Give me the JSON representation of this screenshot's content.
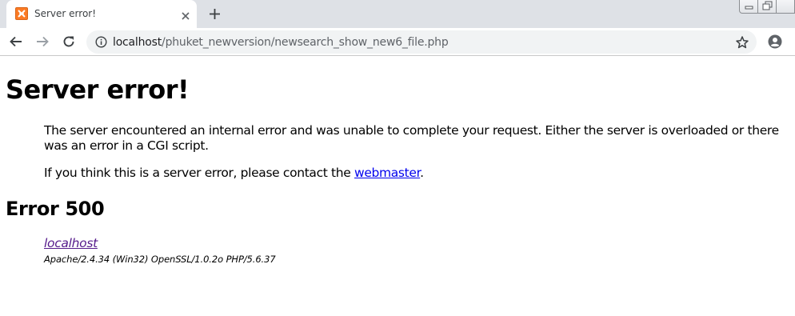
{
  "browser": {
    "tab": {
      "title": "Server error!",
      "favicon": "xampp-favicon"
    },
    "address_bar": {
      "host": "localhost",
      "path": "/phuket_newversion/newsearch_show_new6_file.php"
    },
    "icons": {
      "back": "back-arrow-icon",
      "forward": "forward-arrow-icon",
      "reload": "reload-icon",
      "info": "info-icon",
      "bookmark": "star-icon",
      "account": "account-icon",
      "close_tab": "close-icon",
      "new_tab": "plus-icon"
    },
    "colors": {
      "tabstrip_bg": "#dee1e6",
      "omnibox_bg": "#f1f3f4",
      "favicon": "#fb7a24"
    }
  },
  "page": {
    "heading": "Server error!",
    "message": "The server encountered an internal error and was unable to complete your request. Either the server is overloaded or there was an error in a CGI script.",
    "contact_prefix": "If you think this is a server error, please contact the ",
    "contact_link": "webmaster",
    "contact_suffix": ".",
    "error_heading": "Error 500",
    "address": {
      "host": "localhost",
      "server_signature": "Apache/2.4.34 (Win32) OpenSSL/1.0.2o PHP/5.6.37"
    },
    "colors": {
      "link": "#0000ee",
      "visited_link": "#551a8b"
    }
  }
}
